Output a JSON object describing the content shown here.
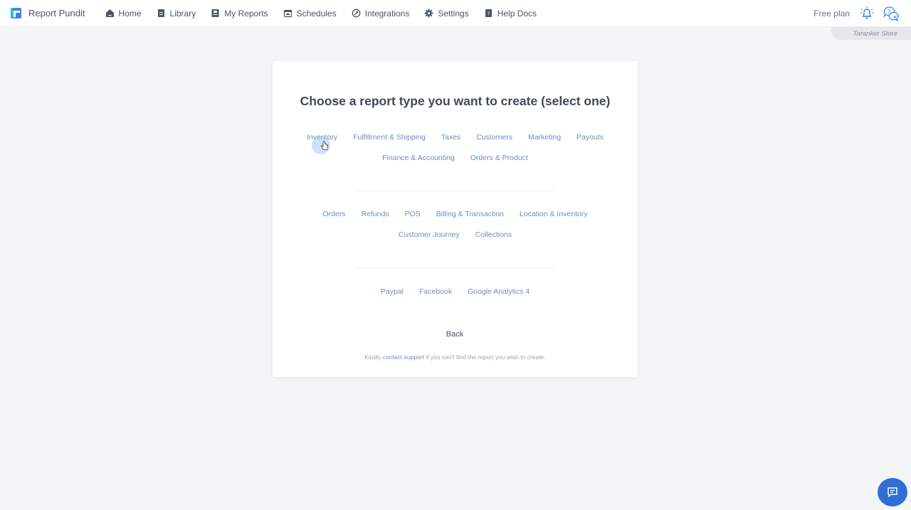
{
  "header": {
    "brand": "Report Pundit",
    "nav": [
      {
        "label": "Home",
        "icon": "home-icon"
      },
      {
        "label": "Library",
        "icon": "library-icon"
      },
      {
        "label": "My Reports",
        "icon": "my-reports-icon"
      },
      {
        "label": "Schedules",
        "icon": "calendar-icon"
      },
      {
        "label": "Integrations",
        "icon": "integrations-icon"
      },
      {
        "label": "Settings",
        "icon": "gear-icon"
      },
      {
        "label": "Help Docs",
        "icon": "help-docs-icon"
      }
    ],
    "plan": "Free plan",
    "store": "Taranker Store"
  },
  "main": {
    "title": "Choose a report type you want to create (select one)",
    "groups": [
      {
        "rows": [
          [
            "Inventory",
            "Fulfillment & Shipping",
            "Taxes",
            "Customers",
            "Marketing",
            "Payouts"
          ],
          [
            "Finance & Accounting",
            "Orders & Product"
          ]
        ]
      },
      {
        "rows": [
          [
            "Orders",
            "Refunds",
            "POS",
            "Billing & Transaction",
            "Location & Inventory"
          ],
          [
            "Customer Journey",
            "Collections"
          ]
        ]
      },
      {
        "rows": [
          [
            "Paypal",
            "Facebook",
            "Google Analytics 4"
          ]
        ]
      }
    ],
    "back_label": "Back",
    "footnote_pre": "Kindly ",
    "footnote_link": "contact support",
    "footnote_post": " if you can't find the report you wish to create."
  },
  "colors": {
    "accent": "#2f6ed4",
    "option_text": "#6e8ebf",
    "title": "#3f4a5c"
  }
}
